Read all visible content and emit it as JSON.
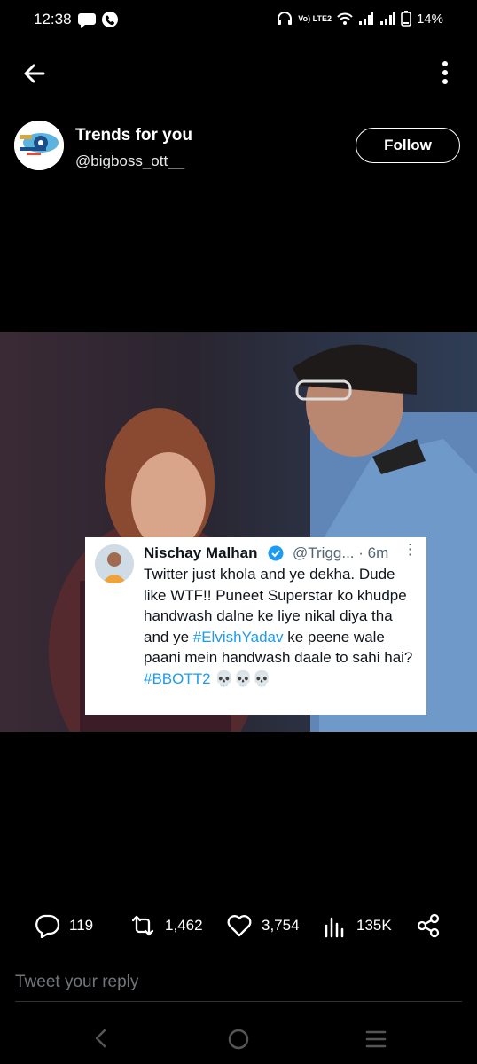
{
  "status_bar": {
    "time": "12:38",
    "network_label": "Vo) LTE2",
    "battery": "14%"
  },
  "header": {
    "display_name": "Trends for you",
    "handle": "@bigboss_ott__",
    "follow_label": "Follow"
  },
  "quote": {
    "name": "Nischay Malhan",
    "handle_time": "@Trigg... · 6m",
    "more": "⋮",
    "text_part1": "Twitter just khola and ye dekha. Dude like WTF!! Puneet Superstar ko khudpe handwash dalne ke liye nikal diya tha and ye ",
    "hashtag1": "#ElvishYadav",
    "text_part2": " ke peene wale paani mein handwash daale to sahi hai? ",
    "hashtag2": "#BBOTT2",
    "emojis": " 💀💀💀"
  },
  "actions": {
    "replies": "119",
    "retweets": "1,462",
    "likes": "3,754",
    "views": "135K"
  },
  "reply": {
    "placeholder": "Tweet your reply"
  },
  "icons": {
    "back": "back-arrow-icon",
    "more": "more-vertical-icon",
    "reply": "reply-icon",
    "retweet": "retweet-icon",
    "like": "heart-icon",
    "views": "views-icon",
    "share": "share-icon"
  }
}
